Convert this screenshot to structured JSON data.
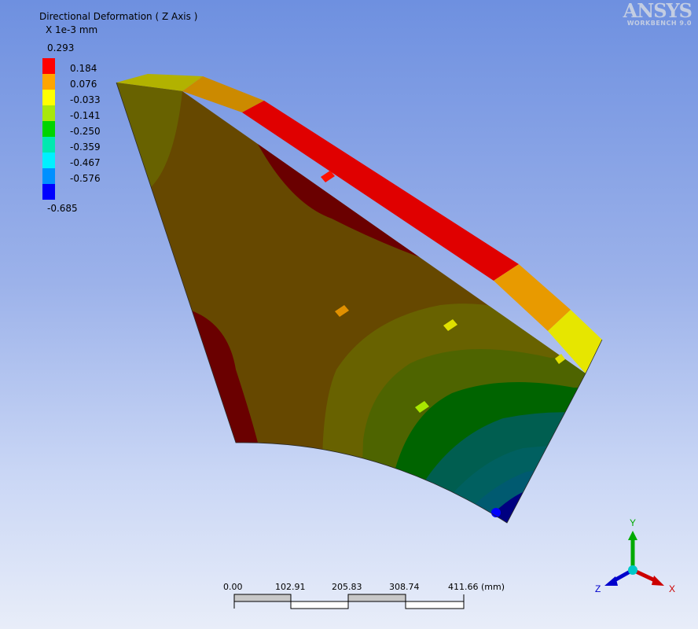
{
  "result": {
    "title": "Directional Deformation ( Z Axis )",
    "unit": "X 1e-3 mm"
  },
  "legend": {
    "max_label": "0.293",
    "min_label": "-0.685",
    "bands": [
      {
        "label": "0.184",
        "color": "#ff0000"
      },
      {
        "label": "0.076",
        "color": "#ffa500"
      },
      {
        "label": "-0.033",
        "color": "#ffff00"
      },
      {
        "label": "-0.141",
        "color": "#a8e80a"
      },
      {
        "label": "-0.250",
        "color": "#00d400"
      },
      {
        "label": "-0.359",
        "color": "#00e8b0"
      },
      {
        "label": "-0.467",
        "color": "#00f0ff"
      },
      {
        "label": "-0.576",
        "color": "#0090ff"
      },
      {
        "label": "",
        "color": "#0000ff"
      }
    ]
  },
  "logo": {
    "brand": "ANSYS",
    "product": "WORKBENCH 9.0"
  },
  "scale_bar": {
    "ticks": [
      "0.00",
      "102.91",
      "205.83",
      "308.74"
    ],
    "last_tick": "411.66 (mm)"
  },
  "triad": {
    "y_label": "Y",
    "z_label": "Z",
    "x_label": "X",
    "y_color": "#00aa00",
    "x_color": "#cc0000",
    "z_color": "#0000cc",
    "origin_color": "#00c8c8"
  }
}
